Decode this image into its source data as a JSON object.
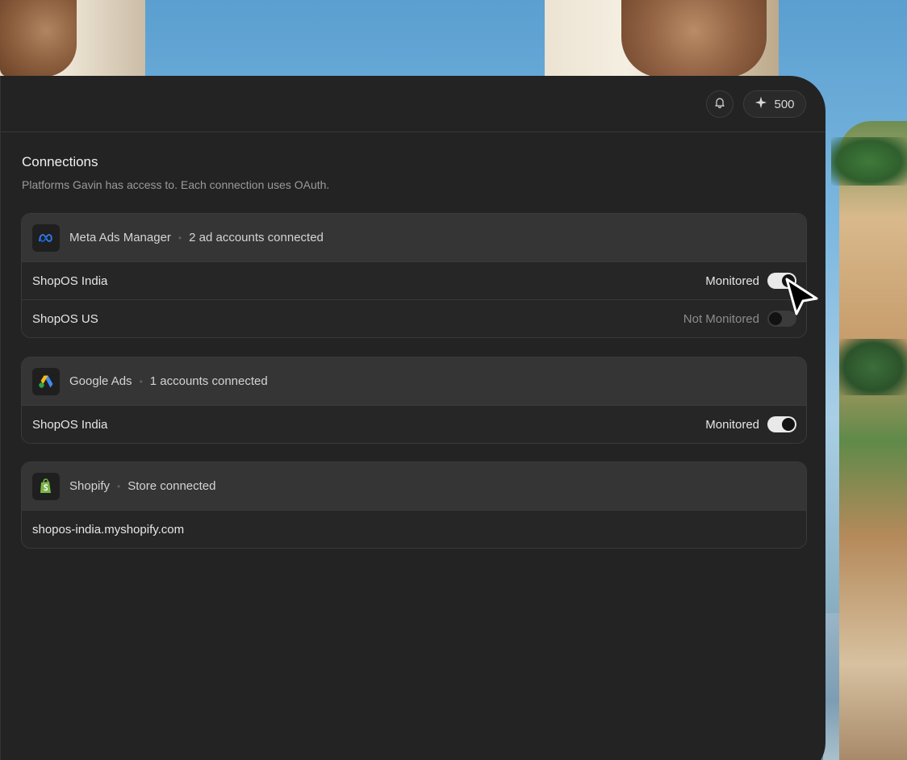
{
  "header": {
    "credits": "500"
  },
  "connections": {
    "title": "Connections",
    "subtitle": "Platforms Gavin has access to. Each connection uses OAuth."
  },
  "cards": [
    {
      "platform": "Meta Ads Manager",
      "summary": "2 ad accounts connected",
      "icon": "meta-logo-icon",
      "accounts": [
        {
          "name": "ShopOS India",
          "status": "Monitored",
          "enabled": true
        },
        {
          "name": "ShopOS US",
          "status": "Not Monitored",
          "enabled": false
        }
      ]
    },
    {
      "platform": "Google Ads",
      "summary": "1 accounts connected",
      "icon": "google-ads-logo-icon",
      "accounts": [
        {
          "name": "ShopOS India",
          "status": "Monitored",
          "enabled": true
        }
      ]
    },
    {
      "platform": "Shopify",
      "summary": "Store connected",
      "icon": "shopify-logo-icon",
      "store": "shopos-india.myshopify.com"
    }
  ],
  "colors": {
    "panel_bg": "#232323",
    "card_header_bg": "#353535",
    "toggle_on": "#e9e9e9",
    "toggle_off": "#3b3b3b"
  }
}
